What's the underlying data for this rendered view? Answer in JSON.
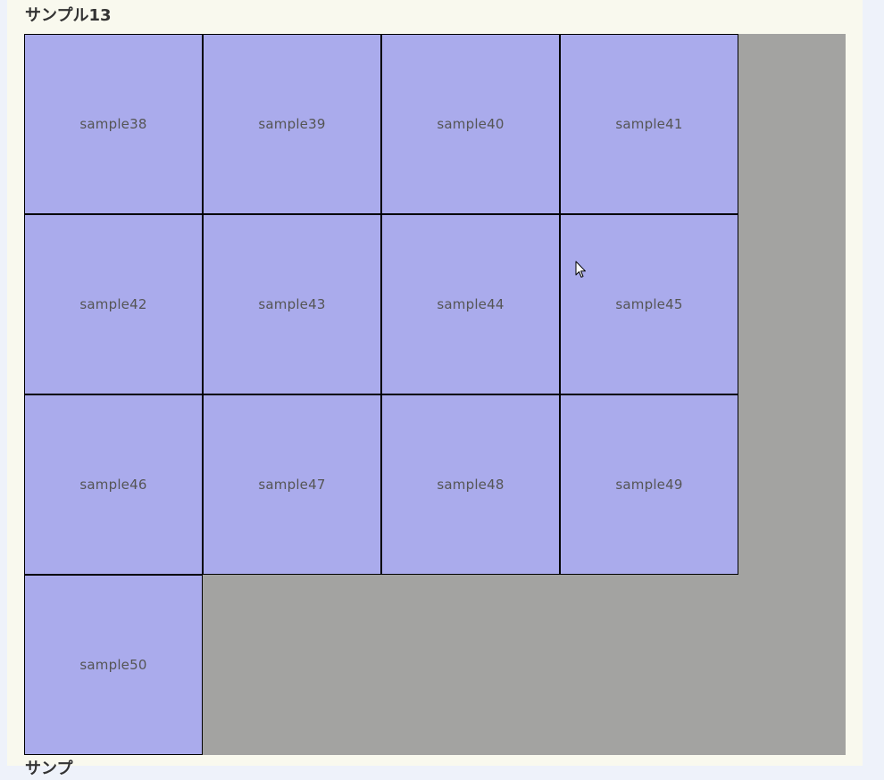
{
  "section": {
    "title": "サンプル13",
    "next_title": "サンプ"
  },
  "colors": {
    "page_background": "#eef2fa",
    "panel_background": "#f9f9ee",
    "grid_background": "#a3a3a1",
    "cell_background": "#aaabec",
    "cell_border": "#000000",
    "cell_text": "#555555"
  },
  "grid": {
    "columns": 4,
    "cells": [
      {
        "label": "sample38"
      },
      {
        "label": "sample39"
      },
      {
        "label": "sample40"
      },
      {
        "label": "sample41"
      },
      {
        "label": "sample42"
      },
      {
        "label": "sample43"
      },
      {
        "label": "sample44"
      },
      {
        "label": "sample45"
      },
      {
        "label": "sample46"
      },
      {
        "label": "sample47"
      },
      {
        "label": "sample48"
      },
      {
        "label": "sample49"
      },
      {
        "label": "sample50"
      }
    ]
  },
  "cursor": {
    "icon": "mouse-pointer-icon"
  }
}
